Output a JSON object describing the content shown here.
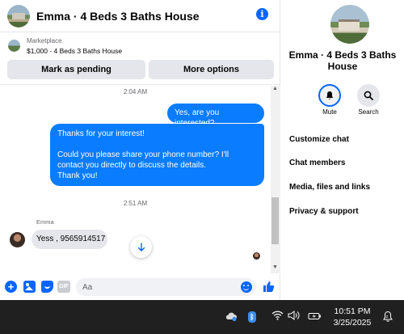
{
  "header": {
    "title": "Emma · 4 Beds 3 Baths House"
  },
  "listing": {
    "kind": "Marketplace",
    "title": "$1,000 - 4 Beds 3 Baths House",
    "mark_pending": "Mark as pending",
    "more_options": "More options"
  },
  "conversation": {
    "timestamp_1": "2:04 AM",
    "out_1": "Yes, are you interested?",
    "out_2_lines": [
      "Thanks for your interest!",
      "Could you please share your phone number? I'll contact you directly to discuss the details.",
      "Thank you!"
    ],
    "timestamp_2": "2:51 AM",
    "sender": "Emma",
    "in_1": "Yess , 9565914517"
  },
  "composer": {
    "placeholder": "Aa",
    "gif_label": "GIF"
  },
  "side_panel": {
    "name": "Emma · 4 Beds 3 Baths House",
    "mute_label": "Mute",
    "search_label": "Search",
    "menu": [
      "Customize chat",
      "Chat members",
      "Media, files and links",
      "Privacy & support"
    ]
  },
  "taskbar": {
    "time": "10:51 PM",
    "date": "3/25/2025"
  },
  "colors": {
    "accent": "#0866ff",
    "bubble_out": "#0a7cff",
    "bubble_in": "#e4e6eb",
    "taskbar": "#202020"
  }
}
